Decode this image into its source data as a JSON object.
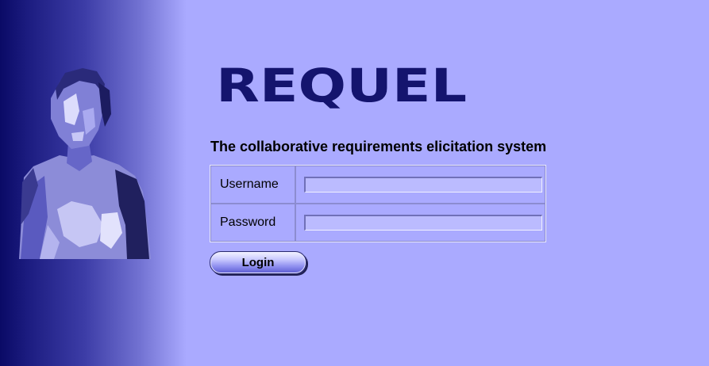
{
  "app": {
    "logo_text": "REQUEL",
    "tagline": "The collaborative requirements elicitation system"
  },
  "login_form": {
    "username_label": "Username",
    "username_value": "",
    "password_label": "Password",
    "password_value": "",
    "login_button_label": "Login"
  },
  "colors": {
    "background": "#aaaaff",
    "sidebar_dark": "#0a0a66",
    "logo": "#14146e",
    "input_background": "#bbbbff"
  }
}
